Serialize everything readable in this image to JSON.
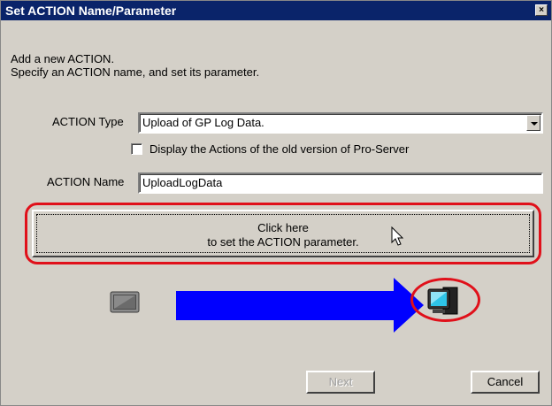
{
  "window": {
    "title": "Set ACTION Name/Parameter",
    "close_glyph": "×"
  },
  "intro": {
    "line1": "Add a new ACTION.",
    "line2": "Specify an ACTION name, and set its parameter."
  },
  "action_type": {
    "label": "ACTION Type",
    "value": "Upload of GP Log Data."
  },
  "old_version_checkbox": {
    "label": "Display the Actions of the old version of Pro-Server",
    "checked": false
  },
  "action_name": {
    "label": "ACTION Name",
    "value": "UploadLogData"
  },
  "parameter_button": {
    "line1": "Click here",
    "line2": "to set the ACTION parameter."
  },
  "buttons": {
    "next": "Next",
    "cancel": "Cancel"
  },
  "icons": [
    "display-panel-icon",
    "flow-arrow-icon",
    "pc-monitor-icon",
    "mouse-cursor-icon"
  ],
  "colors": {
    "title_bar": "#0a246a",
    "highlight": "#e0101a",
    "arrow": "#0000ff",
    "face": "#d4d0c8"
  }
}
